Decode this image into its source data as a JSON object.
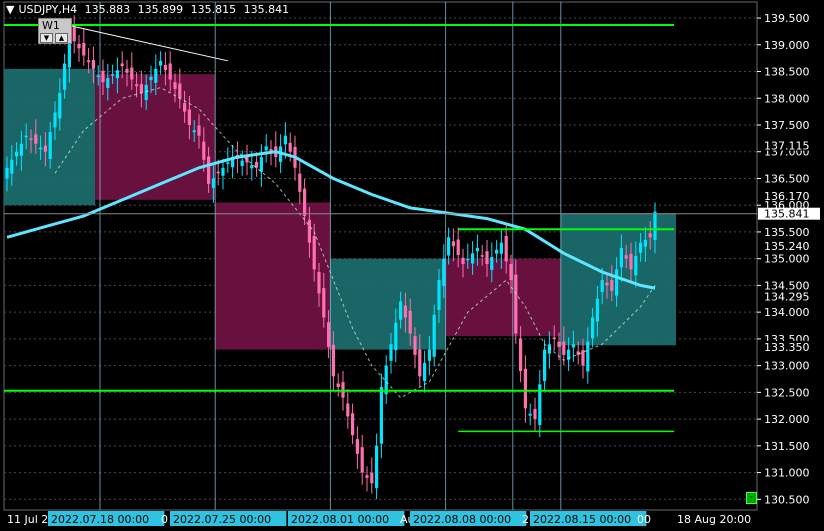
{
  "header": {
    "symbol": "USDJPY,H4",
    "open": "135.883",
    "high": "135.899",
    "low": "135.815",
    "close": "135.841"
  },
  "drawing_tool": {
    "label": "W1",
    "up_glyph": "▲",
    "down_glyph": "▼"
  },
  "corner_button": "-",
  "colors": {
    "background": "#000000",
    "bull": "#00e5ff",
    "bear": "#ff6fae",
    "ma": "#5ee6ff",
    "level": "#00ff00",
    "teal_zone": "#1b6b6b",
    "pink_zone": "#6e1241",
    "grid": "#4a4a4a",
    "session": "#8ecfe6"
  },
  "x_axis": {
    "labels": [
      {
        "text": "11 Jul 2",
        "highlight": false
      },
      {
        "text": "2022.07.18 00:00",
        "highlight": true
      },
      {
        "text": "0",
        "highlight": false
      },
      {
        "text": "2022.07.25 00:00",
        "highlight": true
      },
      {
        "text": "2022.08.01 00:00",
        "highlight": true
      },
      {
        "text": "Au",
        "highlight": false
      },
      {
        "text": "2022.08.08 00:00",
        "highlight": true
      },
      {
        "text": "2",
        "highlight": false
      },
      {
        "text": "2022.08.15 00:00",
        "highlight": true
      },
      {
        "text": "00",
        "highlight": false
      },
      {
        "text": "18 Aug 20:00",
        "highlight": false
      }
    ]
  },
  "y_axis": {
    "min": 130.3,
    "max": 139.8,
    "ticks": [
      "139.500",
      "139.000",
      "138.500",
      "138.000",
      "137.500",
      "137.000",
      "136.500",
      "136.000",
      "135.500",
      "135.000",
      "134.500",
      "134.000",
      "133.500",
      "133.000",
      "132.500",
      "132.000",
      "131.500",
      "131.000",
      "130.500"
    ],
    "tag_labels": [
      {
        "text": "137.115",
        "value": 137.115
      },
      {
        "text": "136.170",
        "value": 136.17
      },
      {
        "text": "135.240",
        "value": 135.24
      },
      {
        "text": "134.295",
        "value": 134.295
      },
      {
        "text": "133.350",
        "value": 133.35
      }
    ],
    "current_price": {
      "text": "135.841",
      "value": 135.841
    }
  },
  "chart_data": {
    "type": "candlestick",
    "levels": [
      139.37,
      135.55,
      132.53,
      131.77
    ],
    "zones": [
      {
        "kind": "teal",
        "from": 0,
        "to": 19,
        "high": 138.55,
        "low": 136.0
      },
      {
        "kind": "pink",
        "from": 19,
        "to": 44,
        "high": 138.45,
        "low": 136.1
      },
      {
        "kind": "pink",
        "from": 44,
        "to": 68,
        "high": 136.05,
        "low": 133.3
      },
      {
        "kind": "teal",
        "from": 68,
        "to": 92,
        "high": 135.0,
        "low": 133.3
      },
      {
        "kind": "pink",
        "from": 92,
        "to": 116,
        "high": 135.0,
        "low": 133.55
      },
      {
        "kind": "teal",
        "from": 116,
        "to": 140,
        "high": 135.85,
        "low": 133.38
      }
    ],
    "session_starts": [
      20,
      44,
      68,
      92,
      106,
      116
    ],
    "anchors": [
      [
        0,
        136.7
      ],
      [
        4,
        137.3
      ],
      [
        8,
        137.0
      ],
      [
        11,
        138.1
      ],
      [
        13,
        139.2
      ],
      [
        16,
        138.8
      ],
      [
        20,
        138.3
      ],
      [
        24,
        138.6
      ],
      [
        28,
        138.1
      ],
      [
        32,
        138.7
      ],
      [
        36,
        138.0
      ],
      [
        38,
        137.5
      ],
      [
        40,
        137.3
      ],
      [
        42,
        136.4
      ],
      [
        44,
        136.6
      ],
      [
        47,
        136.9
      ],
      [
        50,
        136.8
      ],
      [
        52,
        136.7
      ],
      [
        54,
        137.1
      ],
      [
        56,
        136.9
      ],
      [
        58,
        137.3
      ],
      [
        60,
        136.7
      ],
      [
        62,
        135.8
      ],
      [
        64,
        134.8
      ],
      [
        66,
        133.9
      ],
      [
        68,
        132.8
      ],
      [
        70,
        132.4
      ],
      [
        72,
        131.7
      ],
      [
        74,
        131.0
      ],
      [
        76,
        130.8
      ],
      [
        77,
        131.5
      ],
      [
        78,
        132.6
      ],
      [
        80,
        133.4
      ],
      [
        82,
        134.2
      ],
      [
        84,
        133.6
      ],
      [
        86,
        132.8
      ],
      [
        88,
        133.3
      ],
      [
        90,
        134.6
      ],
      [
        92,
        135.4
      ],
      [
        95,
        134.9
      ],
      [
        98,
        135.2
      ],
      [
        100,
        134.9
      ],
      [
        103,
        135.3
      ],
      [
        105,
        134.6
      ],
      [
        106,
        133.6
      ],
      [
        108,
        132.2
      ],
      [
        110,
        132.0
      ],
      [
        112,
        133.3
      ],
      [
        114,
        133.5
      ],
      [
        116,
        133.2
      ],
      [
        118,
        133.4
      ],
      [
        120,
        133.0
      ],
      [
        122,
        133.9
      ],
      [
        124,
        134.6
      ],
      [
        126,
        134.4
      ],
      [
        128,
        135.2
      ],
      [
        130,
        134.8
      ],
      [
        132,
        135.3
      ],
      [
        134,
        135.4
      ],
      [
        135,
        135.88
      ]
    ],
    "ma_series": [
      [
        0,
        135.4
      ],
      [
        8,
        135.6
      ],
      [
        16,
        135.8
      ],
      [
        24,
        136.1
      ],
      [
        32,
        136.4
      ],
      [
        40,
        136.7
      ],
      [
        48,
        136.9
      ],
      [
        56,
        137.0
      ],
      [
        60,
        136.9
      ],
      [
        64,
        136.7
      ],
      [
        68,
        136.5
      ],
      [
        76,
        136.2
      ],
      [
        84,
        135.95
      ],
      [
        92,
        135.85
      ],
      [
        100,
        135.75
      ],
      [
        108,
        135.55
      ],
      [
        116,
        135.1
      ],
      [
        124,
        134.75
      ],
      [
        132,
        134.5
      ],
      [
        135,
        134.45
      ]
    ],
    "dashed_ma_series": [
      [
        10,
        136.6
      ],
      [
        16,
        137.4
      ],
      [
        24,
        138.0
      ],
      [
        32,
        138.2
      ],
      [
        40,
        137.8
      ],
      [
        48,
        137.0
      ],
      [
        56,
        136.4
      ],
      [
        64,
        135.5
      ],
      [
        68,
        134.6
      ],
      [
        72,
        133.7
      ],
      [
        76,
        133.0
      ],
      [
        82,
        132.4
      ],
      [
        88,
        132.7
      ],
      [
        96,
        134.0
      ],
      [
        104,
        134.6
      ],
      [
        108,
        134.1
      ],
      [
        112,
        133.4
      ],
      [
        116,
        133.1
      ],
      [
        124,
        133.4
      ],
      [
        132,
        134.1
      ],
      [
        135,
        134.5
      ]
    ],
    "trendline": [
      [
        11,
        139.4
      ],
      [
        46,
        138.7
      ]
    ]
  }
}
